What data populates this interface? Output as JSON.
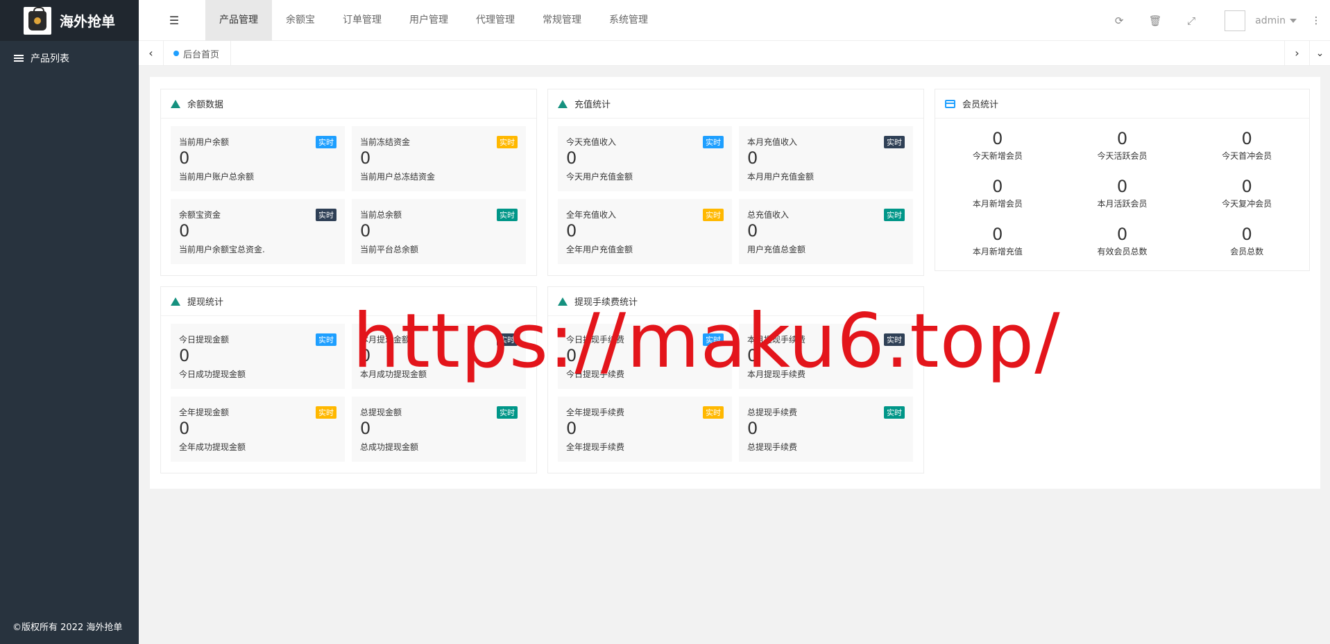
{
  "app": {
    "title": "海外抢单",
    "copyright": "©版权所有 2022 海外抢单"
  },
  "sidebar": {
    "items": [
      {
        "label": "产品列表",
        "icon": "list-icon"
      }
    ]
  },
  "nav": {
    "items": [
      "产品管理",
      "余额宝",
      "订单管理",
      "用户管理",
      "代理管理",
      "常规管理",
      "系统管理"
    ],
    "active": "产品管理"
  },
  "header": {
    "user": "admin",
    "icons": [
      "refresh-icon",
      "trash-icon",
      "fullscreen-icon",
      "more-icon"
    ]
  },
  "tabs": {
    "home": "后台首页"
  },
  "cards": {
    "balance": {
      "title": "余额数据",
      "stats": [
        {
          "label": "当前用户余额",
          "value": "0",
          "desc": "当前用户账户总余额",
          "badge": "实时",
          "badge_color": "#1e9fff"
        },
        {
          "label": "当前冻结资金",
          "value": "0",
          "desc": "当前用户总冻结资金",
          "badge": "实时",
          "badge_color": "#ffb800"
        },
        {
          "label": "余额宝资金",
          "value": "0",
          "desc": "当前用户余额宝总资金.",
          "badge": "实时",
          "badge_color": "#2f4056"
        },
        {
          "label": "当前总余额",
          "value": "0",
          "desc": "当前平台总余额",
          "badge": "实时",
          "badge_color": "#009688"
        }
      ]
    },
    "recharge": {
      "title": "充值统计",
      "stats": [
        {
          "label": "今天充值收入",
          "value": "0",
          "desc": "今天用户充值金额",
          "badge": "实时",
          "badge_color": "#1e9fff"
        },
        {
          "label": "本月充值收入",
          "value": "0",
          "desc": "本月用户充值金额",
          "badge": "实时",
          "badge_color": "#2f4056"
        },
        {
          "label": "全年充值收入",
          "value": "0",
          "desc": "全年用户充值金额",
          "badge": "实时",
          "badge_color": "#ffb800"
        },
        {
          "label": "总充值收入",
          "value": "0",
          "desc": "用户充值总金额",
          "badge": "实时",
          "badge_color": "#009688"
        }
      ]
    },
    "members": {
      "title": "会员统计",
      "cells": [
        {
          "value": "0",
          "label": "今天新增会员"
        },
        {
          "value": "0",
          "label": "今天活跃会员"
        },
        {
          "value": "0",
          "label": "今天首冲会员"
        },
        {
          "value": "0",
          "label": "本月新增会员"
        },
        {
          "value": "0",
          "label": "本月活跃会员"
        },
        {
          "value": "0",
          "label": "今天复冲会员"
        },
        {
          "value": "0",
          "label": "本月新增充值"
        },
        {
          "value": "0",
          "label": "有效会员总数"
        },
        {
          "value": "0",
          "label": "会员总数"
        }
      ]
    },
    "withdraw": {
      "title": "提现统计",
      "stats": [
        {
          "label": "今日提现金额",
          "value": "0",
          "desc": "今日成功提现金额",
          "badge": "实时",
          "badge_color": "#1e9fff"
        },
        {
          "label": "本月提现金额",
          "value": "0",
          "desc": "本月成功提现金额",
          "badge": "实时",
          "badge_color": "#2f4056"
        },
        {
          "label": "全年提现金额",
          "value": "0",
          "desc": "全年成功提现金额",
          "badge": "实时",
          "badge_color": "#ffb800"
        },
        {
          "label": "总提现金额",
          "value": "0",
          "desc": "总成功提现金额",
          "badge": "实时",
          "badge_color": "#009688"
        }
      ]
    },
    "fee": {
      "title": "提现手续费统计",
      "stats": [
        {
          "label": "今日提现手续费",
          "value": "0",
          "desc": "今日提现手续费",
          "badge": "实时",
          "badge_color": "#1e9fff"
        },
        {
          "label": "本月提现手续费",
          "value": "0",
          "desc": "本月提现手续费",
          "badge": "实时",
          "badge_color": "#2f4056"
        },
        {
          "label": "全年提现手续费",
          "value": "0",
          "desc": "全年提现手续费",
          "badge": "实时",
          "badge_color": "#ffb800"
        },
        {
          "label": "总提现手续费",
          "value": "0",
          "desc": "总提现手续费",
          "badge": "实时",
          "badge_color": "#009688"
        }
      ]
    }
  },
  "watermark": "https://maku6.top/"
}
